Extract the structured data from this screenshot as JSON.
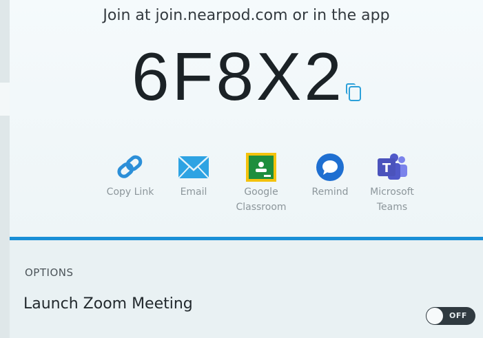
{
  "join": {
    "text": "Join at join.nearpod.com or in the app"
  },
  "code": {
    "value": "6F8X2"
  },
  "share": {
    "items": [
      {
        "label": "Copy Link",
        "icon": "link-icon"
      },
      {
        "label": "Email",
        "icon": "email-icon"
      },
      {
        "label": "Google\nClassroom",
        "icon": "google-classroom-icon"
      },
      {
        "label": "Remind",
        "icon": "remind-icon"
      },
      {
        "label": "Microsoft\nTeams",
        "icon": "microsoft-teams-icon"
      }
    ]
  },
  "options": {
    "header": "OPTIONS",
    "zoom_label": "Launch Zoom Meeting",
    "zoom_toggle_text": "OFF"
  },
  "colors": {
    "accent_blue": "#1a8fd6",
    "teams_purple": "#5059c9",
    "classroom_green": "#1e8e3e",
    "classroom_yellow": "#f4c20d"
  }
}
